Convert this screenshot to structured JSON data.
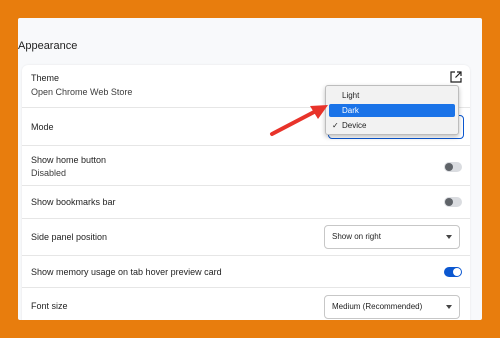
{
  "section": {
    "title": "Appearance"
  },
  "theme": {
    "label": "Theme",
    "sub": "Open Chrome Web Store",
    "icon": "external-link-icon"
  },
  "mode": {
    "label": "Mode",
    "options": [
      {
        "label": "Light",
        "selected": false,
        "checked": false
      },
      {
        "label": "Dark",
        "selected": true,
        "checked": false
      },
      {
        "label": "Device",
        "selected": false,
        "checked": true
      }
    ],
    "checkmark": "✓"
  },
  "home_button": {
    "label": "Show home button",
    "sub": "Disabled",
    "on": false
  },
  "bookmarks_bar": {
    "label": "Show bookmarks bar",
    "on": false
  },
  "side_panel": {
    "label": "Side panel position",
    "value": "Show on right"
  },
  "memory_usage": {
    "label": "Show memory usage on tab hover preview card",
    "on": true
  },
  "font_size": {
    "label": "Font size",
    "value": "Medium (Recommended)"
  },
  "colors": {
    "background": "#e87d0d",
    "accent": "#0b57d0",
    "arrow": "#e8332a",
    "highlight": "#1a73e8"
  }
}
